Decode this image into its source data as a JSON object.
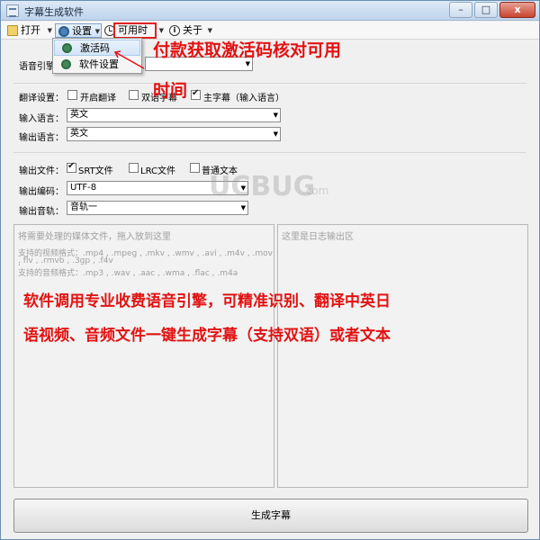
{
  "window": {
    "title": "字幕生成软件",
    "minimize": "–",
    "maximize": "□",
    "close": "x"
  },
  "toolbar": {
    "open": "打开",
    "settings": "设置",
    "available_time": "可用时间",
    "about": "关于"
  },
  "menu": {
    "activation_code": "激活码",
    "software_settings": "软件设置"
  },
  "form": {
    "speech_engine_label": "语音引擎",
    "translate_label": "翻译设置：",
    "enable_translate": "开启翻译",
    "bilingual": "双语字幕",
    "main_subtitle": "主字幕（输入语言）",
    "input_lang_label": "输入语言：",
    "input_lang_value": "英文",
    "output_lang_label": "输出语言：",
    "output_lang_value": "英文",
    "output_file_label": "输出文件：",
    "srt": "SRT文件",
    "lrc": "LRC文件",
    "plain_text": "普通文本",
    "encoding_label": "输出编码：",
    "encoding_value": "UTF-8",
    "audio_track_label": "输出音轨：",
    "audio_track_value": "音轨一"
  },
  "panels": {
    "left_placeholder": "将需要处理的媒体文件，拖入放到这里",
    "video_formats_line1": "支持的视频格式：.mp4 , .mpeg , .mkv , .wmv , .avi , .m4v , .mov ,",
    "video_formats_line2": ". flv , .rmvb , .3gp , .f4v",
    "audio_formats": "支持的音频格式：.mp3 , .wav , .aac , .wma , .flac , .m4a",
    "right_placeholder": "这里是日志输出区"
  },
  "generate_button": "生成字幕",
  "annotations": {
    "line1": "付款获取激活码核对可用",
    "line2": "时间",
    "desc1": "软件调用专业收费语音引擎，可精准识别、翻译中英日",
    "desc2": "语视频、音频文件一键生成字幕（支持双语）或者文本"
  },
  "watermark": {
    "logo": "UCBUG",
    "suffix": ".com"
  },
  "colors": {
    "annotation": "#e21212",
    "highlight_box": "#e02020"
  }
}
